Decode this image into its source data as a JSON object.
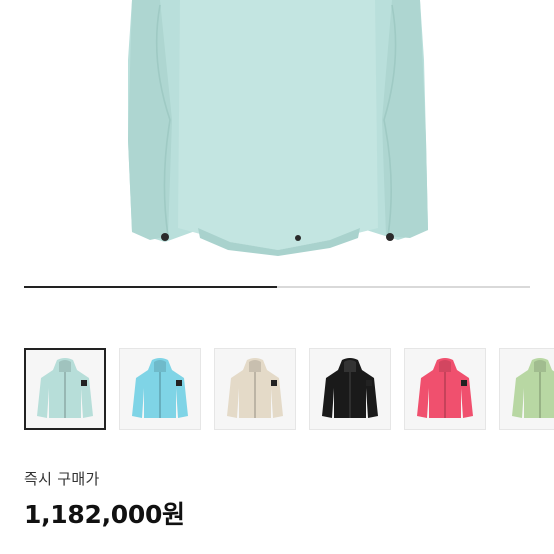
{
  "product": {
    "image_alt": "Hooded jacket, light aqua",
    "image_color": "#b9dfdb",
    "slider_progress": 0.5
  },
  "thumbnails": [
    {
      "name": "aqua",
      "color": "#b7ded9",
      "selected": true
    },
    {
      "name": "sky-blue",
      "color": "#7fd4e6",
      "selected": false
    },
    {
      "name": "beige",
      "color": "#e4dac8",
      "selected": false
    },
    {
      "name": "black",
      "color": "#1a1a1a",
      "selected": false
    },
    {
      "name": "pink",
      "color": "#f0506e",
      "selected": false
    },
    {
      "name": "light-green",
      "color": "#b8d7a3",
      "selected": false
    }
  ],
  "purchase": {
    "label": "즉시 구매가",
    "price": "1,182,000원"
  }
}
